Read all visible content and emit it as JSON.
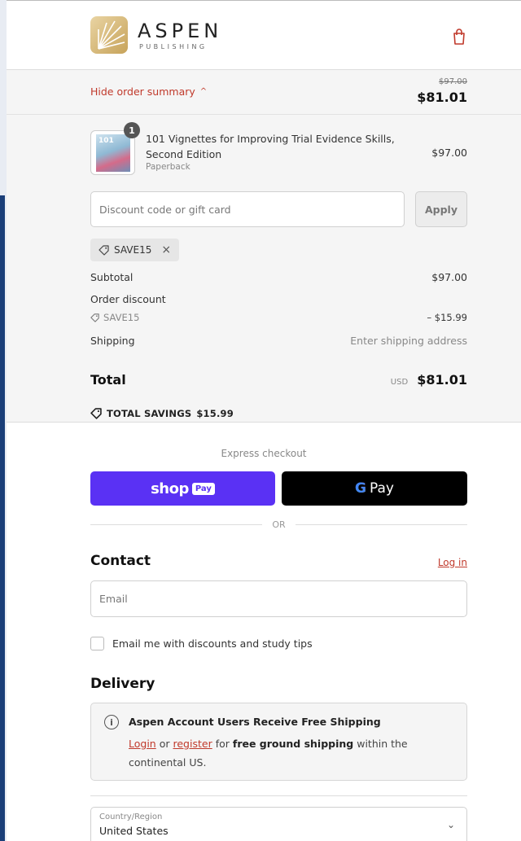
{
  "brand": {
    "name": "ASPEN",
    "sub": "PUBLISHING"
  },
  "summary": {
    "toggle_label": "Hide order summary",
    "toggle_chevron": "^",
    "price_original": "$97.00",
    "price_total": "$81.01"
  },
  "product": {
    "qty": "1",
    "title": "101 Vignettes for Improving Trial Evidence Skills, Second Edition",
    "format": "Paperback",
    "price": "$97.00",
    "cover_text": "101"
  },
  "discount": {
    "placeholder": "Discount code or gift card",
    "apply_label": "Apply",
    "applied_code": "SAVE15",
    "remove_icon": "×"
  },
  "lines": {
    "subtotal_label": "Subtotal",
    "subtotal_value": "$97.00",
    "order_discount_label": "Order discount",
    "discount_code": "SAVE15",
    "discount_value": "– $15.99",
    "shipping_label": "Shipping",
    "shipping_value": "Enter shipping address",
    "total_label": "Total",
    "currency": "USD",
    "total_value": "$81.01",
    "savings_label": "TOTAL SAVINGS",
    "savings_value": "$15.99"
  },
  "express": {
    "label": "Express checkout",
    "shop_label": "shop",
    "shop_pay_chip": "Pay",
    "gpay_label": "Pay",
    "or_label": "OR"
  },
  "contact": {
    "heading": "Contact",
    "login_link": "Log in",
    "email_placeholder": "Email",
    "newsletter_label": "Email me with discounts and study tips"
  },
  "delivery": {
    "heading": "Delivery",
    "notice_title": "Aspen Account Users Receive Free Shipping",
    "notice_login": "Login",
    "notice_or": "or",
    "notice_register": "register",
    "notice_for": "for",
    "notice_bold": "free ground shipping",
    "notice_rest": "within the continental US.",
    "country_label": "Country/Region",
    "country_value": "United States"
  },
  "colors": {
    "accent": "#c0392b",
    "shop_pay": "#5a31f4",
    "gpay": "#000000",
    "summary_bg": "#f5f5f5"
  }
}
